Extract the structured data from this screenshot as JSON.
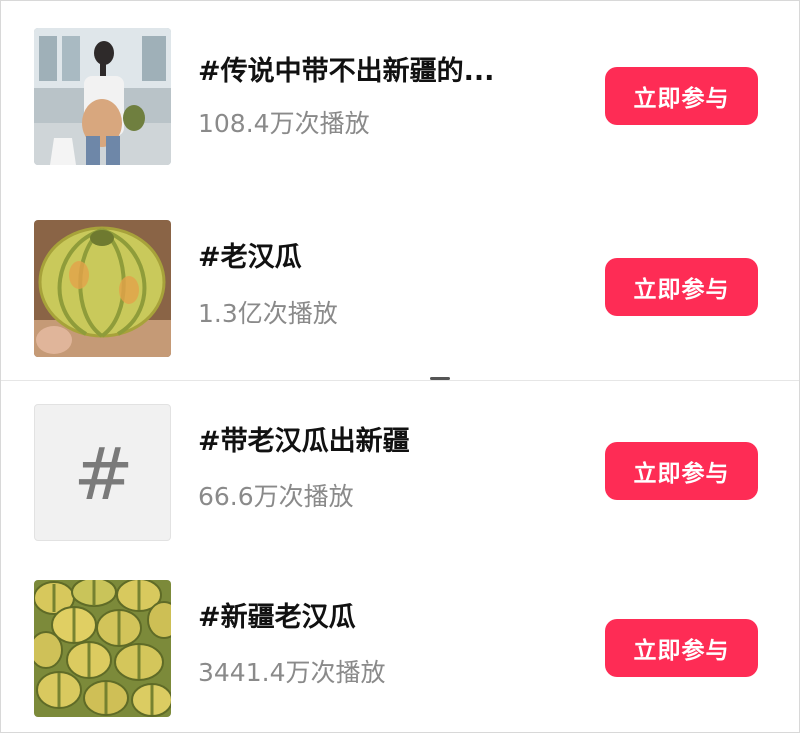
{
  "topics": [
    {
      "title": "#传说中带不出新疆的...",
      "plays": "108.4万次播放",
      "button": "立即参与",
      "thumb_icon": "photo-airport-traveler"
    },
    {
      "title": "#老汉瓜",
      "plays": "1.3亿次播放",
      "button": "立即参与",
      "thumb_icon": "photo-melon"
    },
    {
      "title": "#带老汉瓜出新疆",
      "plays": "66.6万次播放",
      "button": "立即参与",
      "thumb_icon": "hashtag-icon",
      "thumb_glyph": "#"
    },
    {
      "title": "#新疆老汉瓜",
      "plays": "3441.4万次播放",
      "button": "立即参与",
      "thumb_icon": "photo-melon-pile"
    }
  ],
  "colors": {
    "accent": "#fe2c55",
    "title": "#111111",
    "subtext": "#8a8a8a"
  }
}
